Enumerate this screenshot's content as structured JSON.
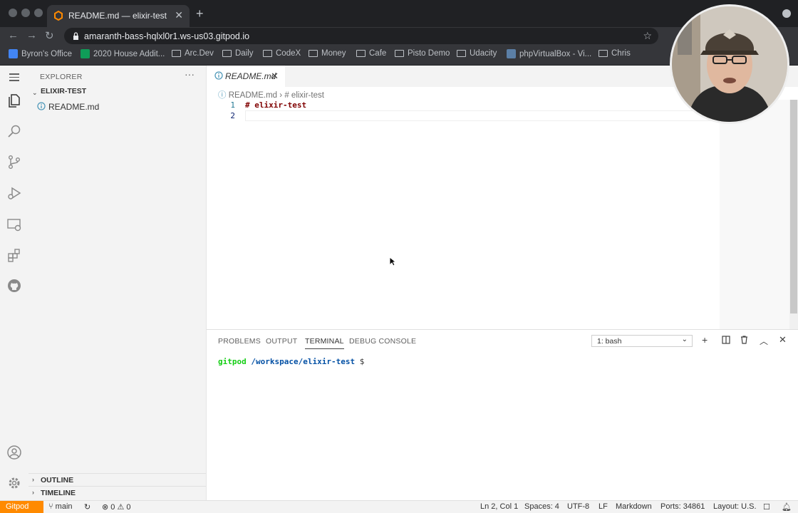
{
  "browser": {
    "tab_title": "README.md — elixir-test — Gitpod",
    "url": "amaranth-bass-hqlxl0r1.ws-us03.gitpod.io",
    "bookmarks": [
      "Byron's Office",
      "2020 House Addit...",
      "Arc.Dev",
      "Daily",
      "CodeX",
      "Money",
      "Cafe",
      "Pisto Demo",
      "Udacity",
      "phpVirtualBox - Vi...",
      "Chris"
    ]
  },
  "sidebar": {
    "title": "EXPLORER",
    "folder": "ELIXIR-TEST",
    "files": [
      "README.md"
    ],
    "outline": "OUTLINE",
    "timeline": "TIMELINE"
  },
  "editor": {
    "tab_label": "README.md",
    "breadcrumb_file": "README.md",
    "breadcrumb_symbol": "# elixir-test",
    "line_numbers": [
      "1",
      "2"
    ],
    "lines": [
      "# elixir-test",
      ""
    ]
  },
  "panel": {
    "tabs": [
      "PROBLEMS",
      "OUTPUT",
      "TERMINAL",
      "DEBUG CONSOLE"
    ],
    "active_tab": "TERMINAL",
    "terminal_select": "1: bash",
    "terminal_user": "gitpod",
    "terminal_path": "/workspace/elixir-test",
    "terminal_prompt": "$"
  },
  "status": {
    "gitpod": "Gitpod",
    "branch": "main",
    "errors": "0",
    "warnings": "0",
    "position": "Ln 2, Col 1",
    "spaces": "Spaces: 4",
    "encoding": "UTF-8",
    "eol": "LF",
    "language": "Markdown",
    "ports": "Ports: 34861",
    "layout": "Layout: U.S."
  },
  "colors": {
    "gitpod_orange": "#ff8a00",
    "terminal_user": "#14ce14",
    "terminal_path": "#0451a5",
    "heading": "#800000"
  }
}
